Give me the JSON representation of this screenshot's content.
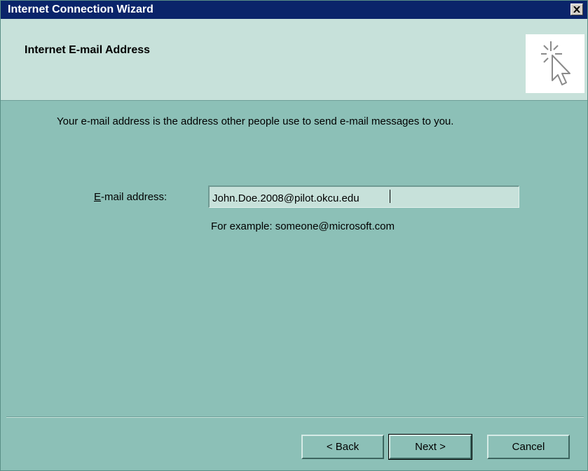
{
  "window": {
    "title": "Internet Connection Wizard",
    "close_glyph": "×"
  },
  "header": {
    "title": "Internet E-mail Address",
    "image_icon": "cursor-click-icon"
  },
  "main": {
    "intro": "Your e-mail address is the address other people use to send e-mail messages to you.",
    "email_label": "E-mail address:",
    "email_value": "John.Doe.2008@pilot.okcu.edu",
    "example": "For example: someone@microsoft.com"
  },
  "buttons": {
    "back": "< Back",
    "next": "Next >",
    "cancel": "Cancel"
  },
  "colors": {
    "titlebar": "#0a246a",
    "dialog_background": "#8cc0b7",
    "header_background": "#c7e1da"
  }
}
